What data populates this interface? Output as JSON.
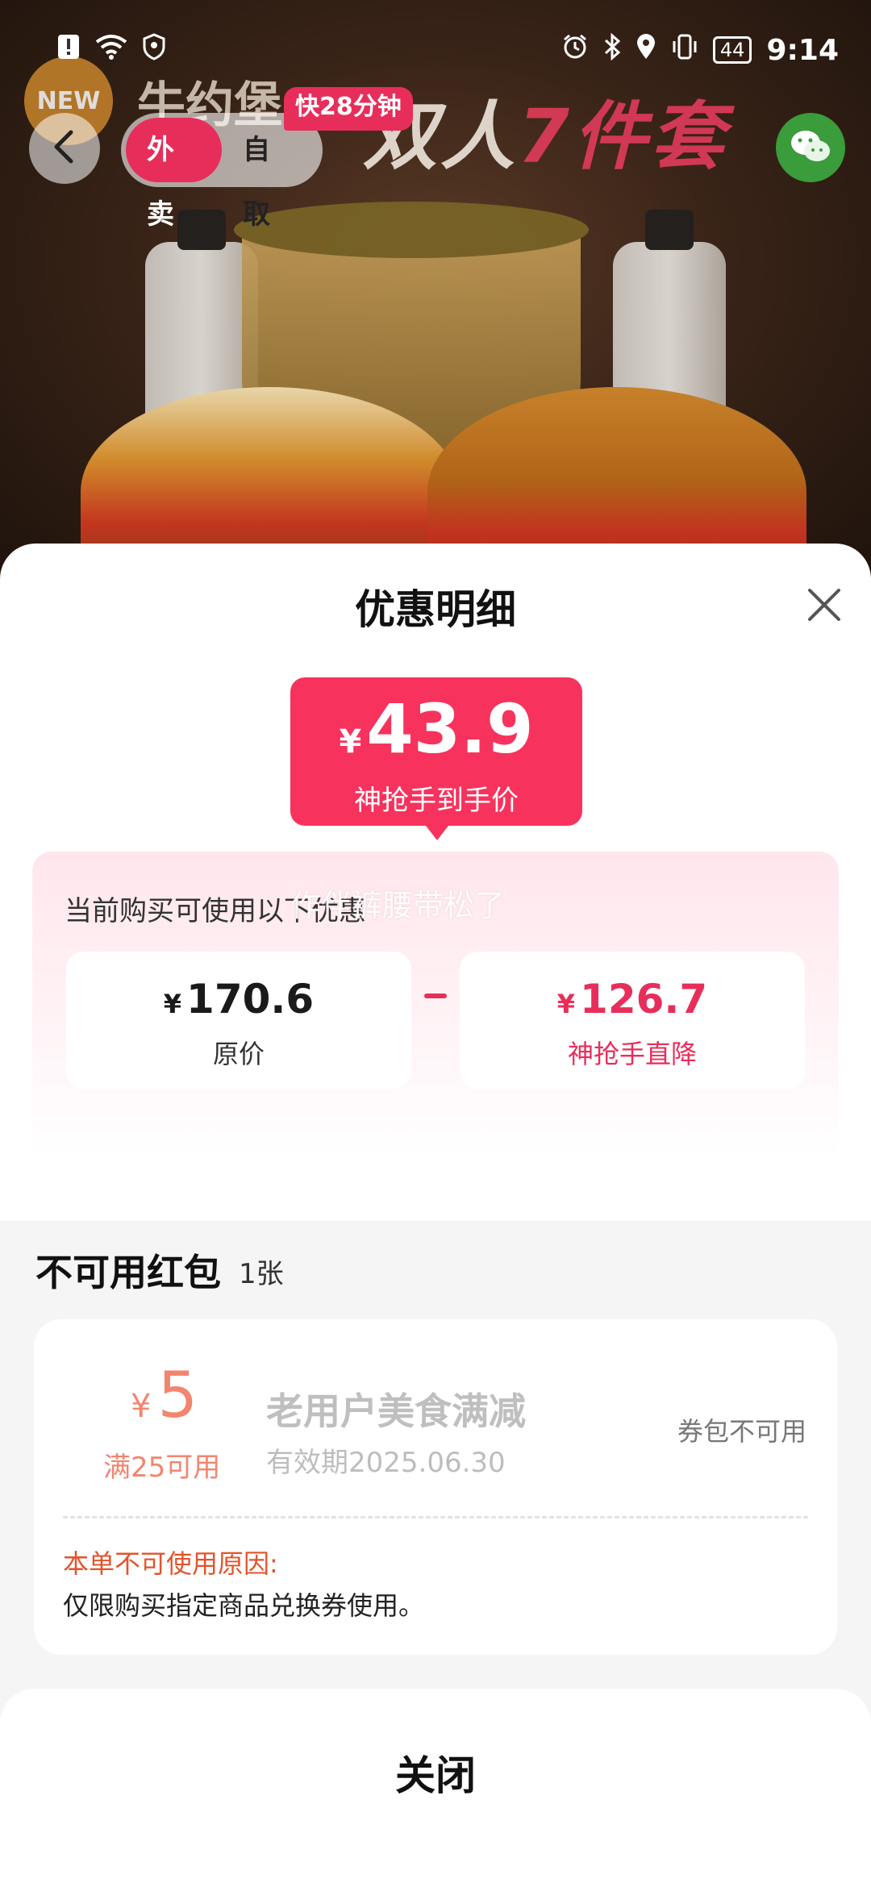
{
  "status_bar": {
    "time": "9:14",
    "battery": "44"
  },
  "header": {
    "mode_delivery": "外卖",
    "mode_pickup": "自取",
    "eta_tag": "快28分钟"
  },
  "hero": {
    "banner_pre": "双人",
    "banner_highlight": "7件套",
    "brand_logo": "NEW",
    "brand_name": "牛约堡"
  },
  "sheet": {
    "title": "优惠明细",
    "final_price": {
      "currency": "¥",
      "amount": "43.9",
      "label": "神抢手到手价"
    },
    "promo_caption": "当前购买可使用以下优惠",
    "watermark": "作伴裤腰带松了",
    "original": {
      "currency": "¥",
      "amount": "170.6",
      "label": "原价"
    },
    "discount": {
      "currency": "¥",
      "amount": "126.7",
      "label": "神抢手直降"
    }
  },
  "unavailable": {
    "title": "不可用红包",
    "count": "1张",
    "coupon": {
      "currency": "¥",
      "amount": "5",
      "condition": "满25可用",
      "name": "老用户美食满减",
      "expiry": "有效期2025.06.30",
      "status": "券包不可用",
      "reason_title": "本单不可使用原因:",
      "reason": "仅限购买指定商品兑换券使用。"
    }
  },
  "footer": {
    "close_label": "关闭"
  },
  "colors": {
    "accent": "#f7335d",
    "coupon_amount": "#f3856f",
    "reason": "#e2542b"
  }
}
